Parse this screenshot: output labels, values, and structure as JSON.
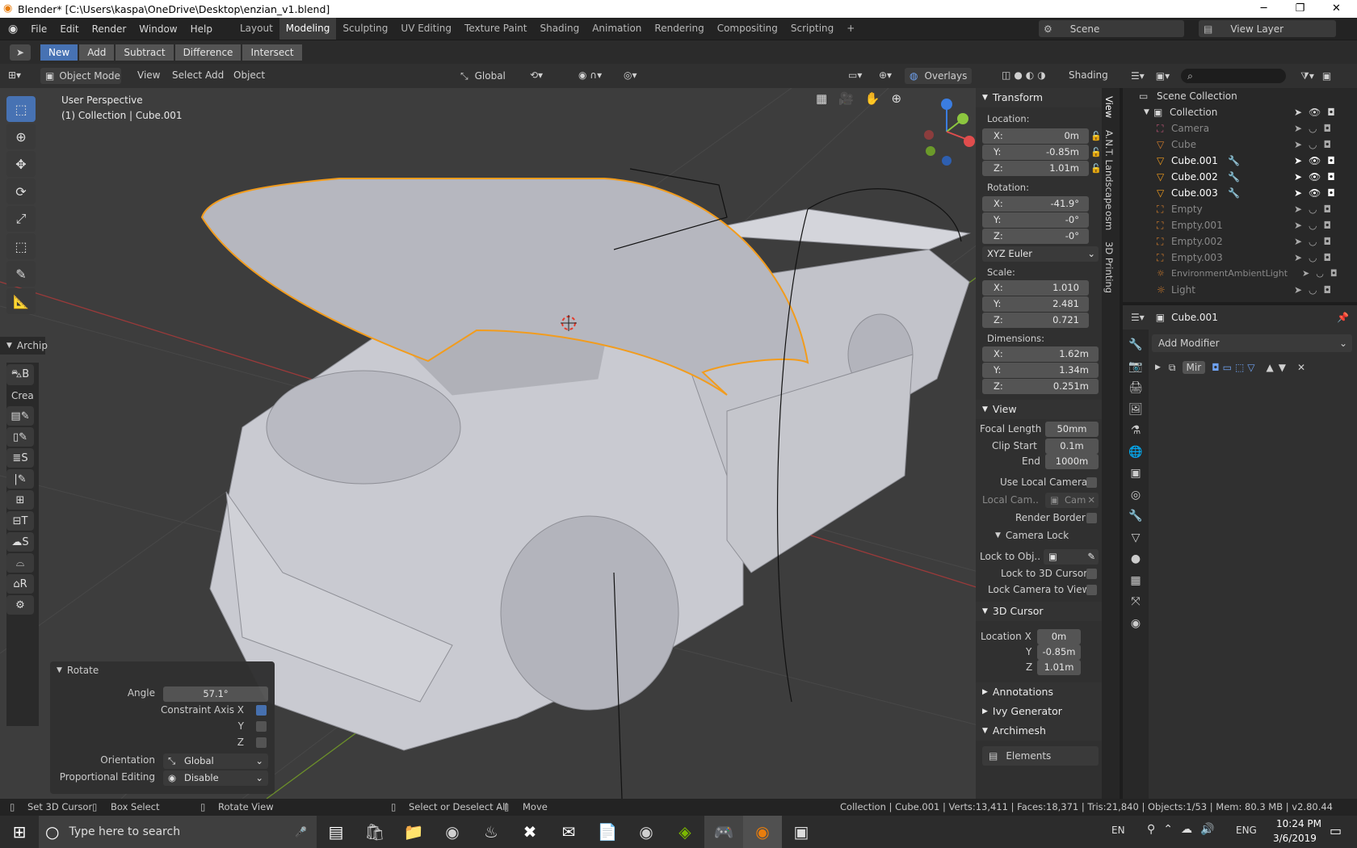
{
  "window": {
    "title": "Blender* [C:\\Users\\kaspa\\OneDrive\\Desktop\\enzian_v1.blend]",
    "minimize": "─",
    "maximize": "❐",
    "close": "✕"
  },
  "menu": [
    "File",
    "Edit",
    "Render",
    "Window",
    "Help"
  ],
  "workspaces": [
    "Layout",
    "Modeling",
    "Sculpting",
    "UV Editing",
    "Texture Paint",
    "Shading",
    "Animation",
    "Rendering",
    "Compositing",
    "Scripting",
    "+"
  ],
  "active_workspace": "Modeling",
  "scene": {
    "label": "Scene",
    "view_layer": "View Layer"
  },
  "booltool": [
    "New",
    "Add",
    "Subtract",
    "Difference",
    "Intersect"
  ],
  "vpheader": {
    "mode": "Object Mode",
    "view": "View",
    "select": "Select",
    "add": "Add",
    "object": "Object",
    "orientation": "Global",
    "overlays": "Overlays",
    "shading": "Shading"
  },
  "viewport": {
    "perspective": "User Perspective",
    "collection": "(1) Collection | Cube.001",
    "archipack_tab": "Archip",
    "crea": "Crea"
  },
  "npanel": {
    "transform": "Transform",
    "location_label": "Location:",
    "location": [
      {
        "k": "X:",
        "v": "0m"
      },
      {
        "k": "Y:",
        "v": "-0.85m"
      },
      {
        "k": "Z:",
        "v": "1.01m"
      }
    ],
    "rotation_label": "Rotation:",
    "rotation": [
      {
        "k": "X:",
        "v": "-41.9°"
      },
      {
        "k": "Y:",
        "v": "-0°"
      },
      {
        "k": "Z:",
        "v": "-0°"
      }
    ],
    "rotation_mode": "XYZ Euler",
    "scale_label": "Scale:",
    "scale": [
      {
        "k": "X:",
        "v": "1.010"
      },
      {
        "k": "Y:",
        "v": "2.481"
      },
      {
        "k": "Z:",
        "v": "0.721"
      }
    ],
    "dimensions_label": "Dimensions:",
    "dimensions": [
      {
        "k": "X:",
        "v": "1.62m"
      },
      {
        "k": "Y:",
        "v": "1.34m"
      },
      {
        "k": "Z:",
        "v": "0.251m"
      }
    ],
    "view": "View",
    "focal_length_label": "Focal Length",
    "focal_length": "50mm",
    "clip_start_label": "Clip Start",
    "clip_start": "0.1m",
    "end_label": "End",
    "clip_end": "1000m",
    "use_local_camera": "Use Local Camera",
    "local_cam_label": "Local Cam..",
    "local_cam_value": "Cam",
    "render_border": "Render Border",
    "camera_lock": "Camera Lock",
    "lock_to_obj": "Lock to Obj..",
    "lock_3d_cursor": "Lock to 3D Cursor",
    "lock_camera_view": "Lock Camera to View",
    "cursor": "3D Cursor",
    "cursor_loc": [
      {
        "k": "Location X",
        "v": "0m"
      },
      {
        "k": "Y",
        "v": "-0.85m"
      },
      {
        "k": "Z",
        "v": "1.01m"
      }
    ],
    "annotations": "Annotations",
    "ivy": "Ivy Generator",
    "archimesh": "Archimesh",
    "elements": "Elements"
  },
  "vtabs": [
    "View",
    "A.N.T. Landscape",
    "osm",
    "3D Printing"
  ],
  "outliner": {
    "scene_collection": "Scene Collection",
    "items": [
      {
        "name": "Collection",
        "indent": 0
      },
      {
        "name": "Camera",
        "indent": 1
      },
      {
        "name": "Cube",
        "indent": 1
      },
      {
        "name": "Cube.001",
        "indent": 1
      },
      {
        "name": "Cube.002",
        "indent": 1
      },
      {
        "name": "Cube.003",
        "indent": 1
      },
      {
        "name": "Empty",
        "indent": 1
      },
      {
        "name": "Empty.001",
        "indent": 1
      },
      {
        "name": "Empty.002",
        "indent": 1
      },
      {
        "name": "Empty.003",
        "indent": 1
      },
      {
        "name": "EnvironmentAmbientLight",
        "indent": 1
      },
      {
        "name": "Light",
        "indent": 1
      }
    ]
  },
  "props": {
    "object": "Cube.001",
    "add_modifier": "Add Modifier",
    "modifier": "Mir"
  },
  "redo": {
    "title": "Rotate",
    "angle_label": "Angle",
    "angle": "57.1°",
    "constraint_label": "Constraint Axis X",
    "y": "Y",
    "z": "Z",
    "orientation_label": "Orientation",
    "orientation": "Global",
    "prop_edit_label": "Proportional Editing",
    "prop_edit": "Disable"
  },
  "status": {
    "set_cursor": "Set 3D Cursor",
    "box_select": "Box Select",
    "rotate_view": "Rotate View",
    "select_all": "Select or Deselect All",
    "move": "Move",
    "stats": "Collection | Cube.001 | Verts:13,411 | Faces:18,371 | Tris:21,840 | Objects:1/53 | Mem: 80.3 MB | v2.80.44"
  },
  "taskbar": {
    "search": "Type here to search",
    "lang": "EN",
    "ime": "ENG",
    "time": "10:24 PM",
    "date": "3/6/2019"
  },
  "colors": {
    "accent": "#4772b3",
    "selection": "#f29c1d",
    "grid_x": "#9b3a3a",
    "grid_y": "#6c8f2a"
  }
}
